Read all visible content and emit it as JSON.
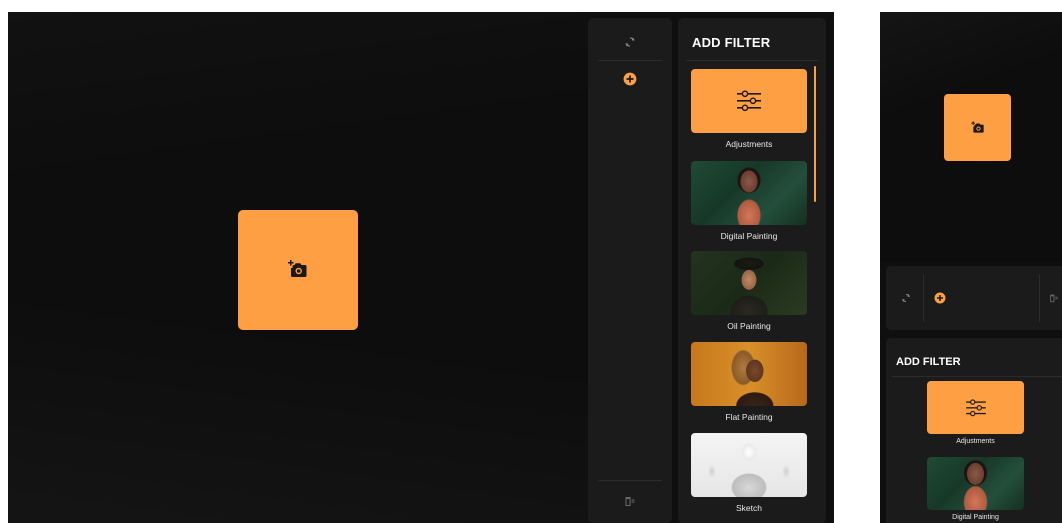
{
  "desktop": {
    "upload_icon": "add-photo-icon",
    "tool_rail": {
      "refresh_icon": "refresh-icon",
      "add_icon": "add-circle-icon",
      "delete_icon": "delete-layers-icon"
    },
    "filter_panel": {
      "title": "ADD FILTER",
      "items": [
        {
          "label": "Adjustments",
          "icon": "sliders-icon"
        },
        {
          "label": "Digital Painting"
        },
        {
          "label": "Oil Painting"
        },
        {
          "label": "Flat Painting"
        },
        {
          "label": "Sketch"
        }
      ]
    }
  },
  "mobile": {
    "upload_icon": "add-photo-icon",
    "toolbar": {
      "refresh_icon": "refresh-icon",
      "add_icon": "add-circle-icon",
      "delete_icon": "delete-layers-icon"
    },
    "filter_panel": {
      "title": "ADD FILTER",
      "items": [
        {
          "label": "Adjustments",
          "icon": "sliders-icon"
        },
        {
          "label": "Digital Painting"
        }
      ]
    }
  },
  "colors": {
    "accent": "#ff9f43",
    "panel": "#1b1b1b",
    "background": "#0f0f0f"
  }
}
